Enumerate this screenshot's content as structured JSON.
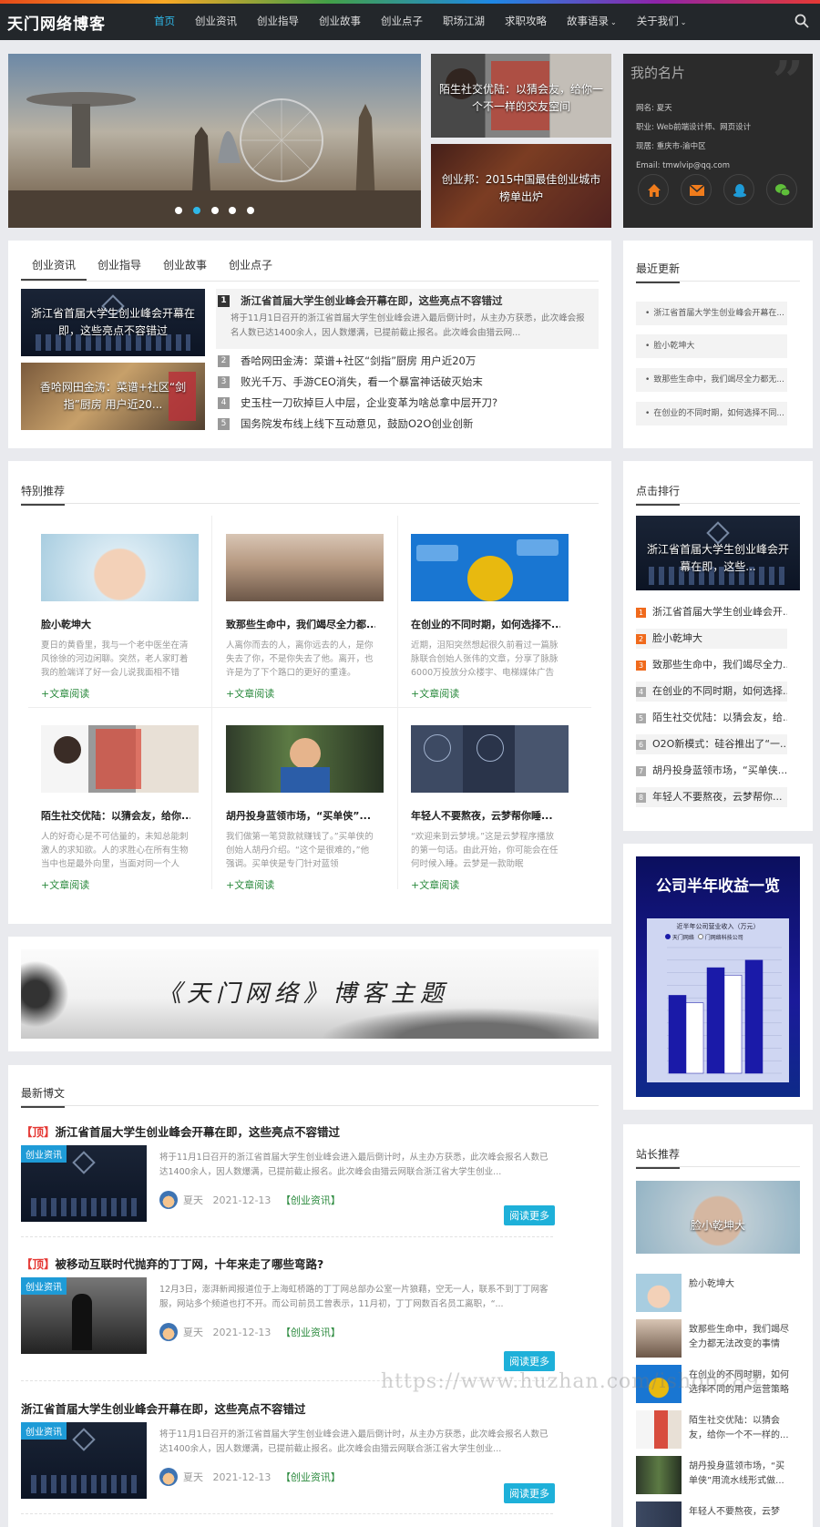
{
  "nav": {
    "logo": "天门网络博客",
    "items": [
      "首页",
      "创业资讯",
      "创业指导",
      "创业故事",
      "创业点子",
      "职场江湖",
      "求职攻略",
      "故事语录",
      "关于我们"
    ],
    "active": 0
  },
  "hero": {
    "side": [
      {
        "caption": "陌生社交优陆：以猜会友，给你一个不一样的交友空间"
      },
      {
        "caption": "创业邦：2015中国最佳创业城市榜单出炉"
      }
    ],
    "dots": 5,
    "active_dot": 1
  },
  "profile": {
    "title": "我的名片",
    "name_label": "网名:",
    "name": "夏天",
    "job_label": "职业:",
    "job": "Web前端设计师、网页设计",
    "addr_label": "现居:",
    "addr": "重庆市-渝中区",
    "email_label": "Email:",
    "email": "tmwlvip@qq.com",
    "icons": [
      "home-icon",
      "mail-icon",
      "qq-icon",
      "wechat-icon"
    ],
    "icon_color": "#f07c1c"
  },
  "news": {
    "tabs": [
      "创业资讯",
      "创业指导",
      "创业故事",
      "创业点子"
    ],
    "left": [
      {
        "caption": "浙江省首届大学生创业峰会开幕在即，这些亮点不容错过"
      },
      {
        "caption": "香哈网田金涛：菜谱+社区“剑指”厨房 用户近20..."
      }
    ],
    "top": {
      "num": "1",
      "title": "浙江省首届大学生创业峰会开幕在即，这些亮点不容错过",
      "desc": "将于11月1日召开的浙江省首届大学生创业峰会进入最后倒计时，从主办方获悉，此次峰会报名人数已达1400余人，因人数爆满，已提前截止报名。此次峰会由猎云网..."
    },
    "list": [
      {
        "num": "2",
        "title": "香哈网田金涛：菜谱+社区“剑指”厨房 用户近20万"
      },
      {
        "num": "3",
        "title": "败光千万、手游CEO消失，看一个暴富神话破灭始末"
      },
      {
        "num": "4",
        "title": "史玉柱一刀砍掉巨人中层，企业变革为啥总拿中层开刀?"
      },
      {
        "num": "5",
        "title": "国务院发布线上线下互动意见，鼓励O2O创业创新"
      }
    ]
  },
  "recent": {
    "title": "最近更新",
    "items": [
      "浙江省首届大学生创业峰会开幕在...",
      "脸小乾坤大",
      "致那些生命中，我们竭尽全力都无...",
      "在创业的不同时期，如何选择不同..."
    ]
  },
  "special": {
    "title": "特别推荐",
    "more": "+文章阅读",
    "items": [
      {
        "title": "脸小乾坤大",
        "desc": "夏日的黄昏里，我与一个老中医坐在清风徐徐的河边闲聊。突然，老人家盯着我的脸端详了好一会儿说我面相不错"
      },
      {
        "title": "致那些生命中，我们竭尽全力都...",
        "desc": "人离你而去的人，离你远去的人，是你失去了你，不是你失去了他。离开，也许是为了下个路口的更好的重逢。"
      },
      {
        "title": "在创业的不同时期，如何选择不...",
        "desc": "近期，沮阳突然想起很久前看过一篇脉脉联合创始人张伟的文章，分享了脉脉6000万投放分众楼宇、电梯媒体广告"
      },
      {
        "title": "陌生社交优陆：以猜会友，给你...",
        "desc": "人的好奇心是不可估量的，未知总能刺激人的求知欲。人的求胜心在所有生物当中也是最外向里，当面对同一个人"
      },
      {
        "title": "胡丹投身蓝领市场，“买单侠”...",
        "desc": "我们做第一笔贷款就赚钱了。”买单侠的创始人胡丹介绍。“这个是很难的，”他强调。买单侠是专门针对蓝领"
      },
      {
        "title": "年轻人不要熬夜，云梦帮你睡...",
        "desc": "“欢迎来到云梦境。”这是云梦程序播放的第一句话。由此开始，你可能会在任何时候入睡。云梦是一款助眠"
      }
    ]
  },
  "rank": {
    "title": "点击排行",
    "top_caption": "浙江省首届大学生创业峰会开幕在即，这些...",
    "items": [
      {
        "num": "1",
        "title": "浙江省首届大学生创业峰会开..."
      },
      {
        "num": "2",
        "title": "脸小乾坤大"
      },
      {
        "num": "3",
        "title": "致那些生命中，我们竭尽全力..."
      },
      {
        "num": "4",
        "title": "在创业的不同时期，如何选择..."
      },
      {
        "num": "5",
        "title": "陌生社交优陆：以猜会友，给..."
      },
      {
        "num": "6",
        "title": "O2O新模式：硅谷推出了“一..."
      },
      {
        "num": "7",
        "title": "胡丹投身蓝领市场，“买单侠..."
      },
      {
        "num": "8",
        "title": "年轻人不要熬夜，云梦帮你..."
      }
    ],
    "colors": [
      "#f06a1c",
      "#f06a1c",
      "#f06a1c",
      "#aaa",
      "#aaa",
      "#aaa",
      "#aaa",
      "#aaa"
    ]
  },
  "banner": {
    "text": "《天门网络》博客主题"
  },
  "ad": {
    "title": "公司半年收益一览",
    "chart_title": "近半年公司营业收入（万元）",
    "legend": [
      "天门网络",
      "门网络科技公司"
    ],
    "chart_data": {
      "type": "bar",
      "categories": [
        "1",
        "2",
        "3"
      ],
      "series": [
        {
          "name": "天门网络",
          "values": [
            62,
            84,
            90
          ]
        },
        {
          "name": "门网络科技公司",
          "values": [
            56,
            78,
            0
          ]
        }
      ],
      "ylim": [
        0,
        100
      ]
    }
  },
  "latest": {
    "title": "最新博文",
    "read_more": "阅读更多",
    "posts": [
      {
        "top": "【顶】",
        "title": "浙江省首届大学生创业峰会开幕在即，这些亮点不容错过",
        "badge": "创业资讯",
        "desc": "将于11月1日召开的浙江省首届大学生创业峰会进入最后倒计时，从主办方获悉，此次峰会报名人数已达1400余人，因人数爆满，已提前截止报名。此次峰会由猎云网联合浙江省大学生创业...",
        "author": "夏天",
        "date": "2021-12-13",
        "cat": "【创业资讯】"
      },
      {
        "top": "【顶】",
        "title": "被移动互联时代抛弃的丁丁网，十年来走了哪些弯路?",
        "badge": "创业资讯",
        "desc": "12月3日，澎湃新闻报道位于上海虹桥路的丁丁网总部办公室一片狼藉，空无一人，联系不到丁丁网客服，网站多个频道也打不开。而公司前员工曾表示，11月初，丁丁网数百名员工离职，“...",
        "author": "夏天",
        "date": "2021-12-13",
        "cat": "【创业资讯】"
      },
      {
        "top": "",
        "title": "浙江省首届大学生创业峰会开幕在即，这些亮点不容错过",
        "badge": "创业资讯",
        "desc": "将于11月1日召开的浙江省首届大学生创业峰会进入最后倒计时，从主办方获悉，此次峰会报名人数已达1400余人，因人数爆满，已提前截止报名。此次峰会由猎云网联合浙江省大学生创业...",
        "author": "夏天",
        "date": "2021-12-13",
        "cat": "【创业资讯】"
      }
    ]
  },
  "recommend": {
    "title": "站长推荐",
    "top_caption": "脸小乾坤大",
    "items": [
      "脸小乾坤大",
      "致那些生命中，我们竭尽全力都无法改变的事情",
      "在创业的不同时期，如何选择不同的用户运营策略",
      "陌生社交优陆：以猜会友，给你一个不一样的...",
      "胡丹投身蓝领市场，“买单侠”用流水线形式做...",
      "年轻人不要熬夜，云梦"
    ]
  },
  "watermark": "https://www.huzhan.com/ishop289"
}
